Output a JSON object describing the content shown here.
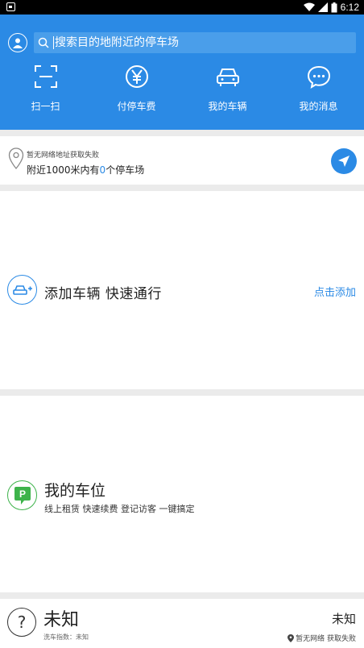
{
  "status_bar": {
    "time": "6:12"
  },
  "header": {
    "search_placeholder": "搜索目的地附近的停车场",
    "quick_actions": [
      {
        "label": "扫一扫",
        "icon": "scan-icon"
      },
      {
        "label": "付停车费",
        "icon": "yen-icon"
      },
      {
        "label": "我的车辆",
        "icon": "car-icon"
      },
      {
        "label": "我的消息",
        "icon": "message-icon"
      }
    ]
  },
  "location": {
    "status": "暂无网络地址获取失败",
    "nearby_prefix": "附近1000米内有",
    "nearby_count": "0",
    "nearby_suffix": "个停车场"
  },
  "add_vehicle": {
    "title": "添加车辆  快速通行",
    "action": "点击添加"
  },
  "my_spot": {
    "title": "我的车位",
    "subtitle": "线上租赁 快速续费 登记访客 一键搞定"
  },
  "weather": {
    "condition": "未知",
    "wash_index": "洗车指数：未知",
    "right_value": "未知",
    "right_status": "暂无网络 获取失败"
  },
  "colors": {
    "primary": "#2b8ae5",
    "green": "#3db34a",
    "divider": "#ebebeb"
  }
}
